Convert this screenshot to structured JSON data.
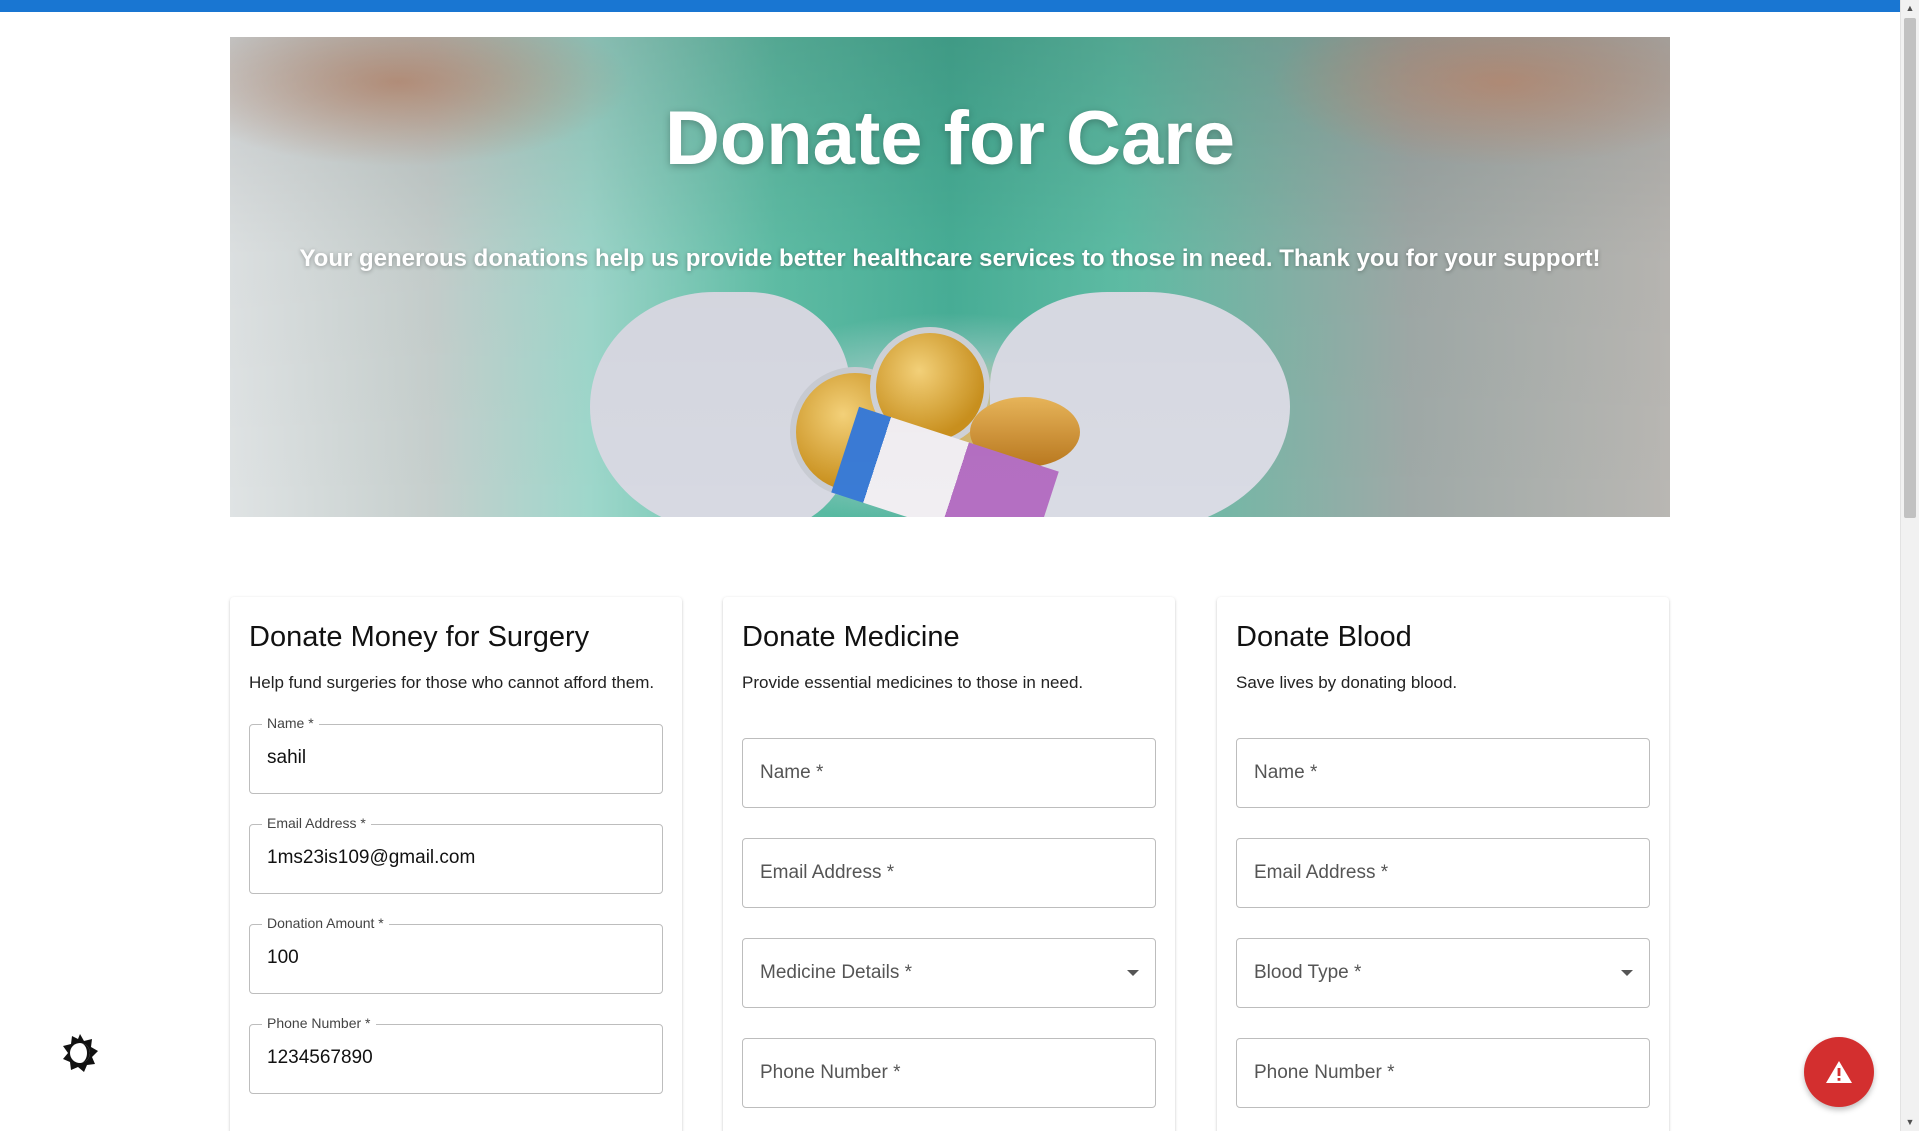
{
  "hero": {
    "title": "Donate for Care",
    "subtitle": "Your generous donations help us provide better healthcare services to those in need. Thank you for your support!"
  },
  "cards": [
    {
      "title": "Donate Money for Surgery",
      "description": "Help fund surgeries for those who cannot afford them.",
      "fields": [
        {
          "label": "Name *",
          "value": "sahil"
        },
        {
          "label": "Email Address *",
          "value": "1ms23is109@gmail.com"
        },
        {
          "label": "Donation Amount *",
          "value": "100"
        },
        {
          "label": "Phone Number *",
          "value": "1234567890"
        }
      ]
    },
    {
      "title": "Donate Medicine",
      "description": "Provide essential medicines to those in need.",
      "fields": [
        {
          "placeholder": "Name *"
        },
        {
          "placeholder": "Email Address *"
        },
        {
          "placeholder": "Medicine Details *"
        },
        {
          "placeholder": "Phone Number *"
        }
      ]
    },
    {
      "title": "Donate Blood",
      "description": "Save lives by donating blood.",
      "fields": [
        {
          "placeholder": "Name *"
        },
        {
          "placeholder": "Email Address *"
        },
        {
          "placeholder": "Blood Type *"
        },
        {
          "placeholder": "Phone Number *"
        }
      ]
    }
  ],
  "icons": {
    "theme_toggle": "brightness-icon",
    "alert": "warning-icon"
  },
  "colors": {
    "accent": "#1976d2",
    "alert": "#d32f2f"
  }
}
